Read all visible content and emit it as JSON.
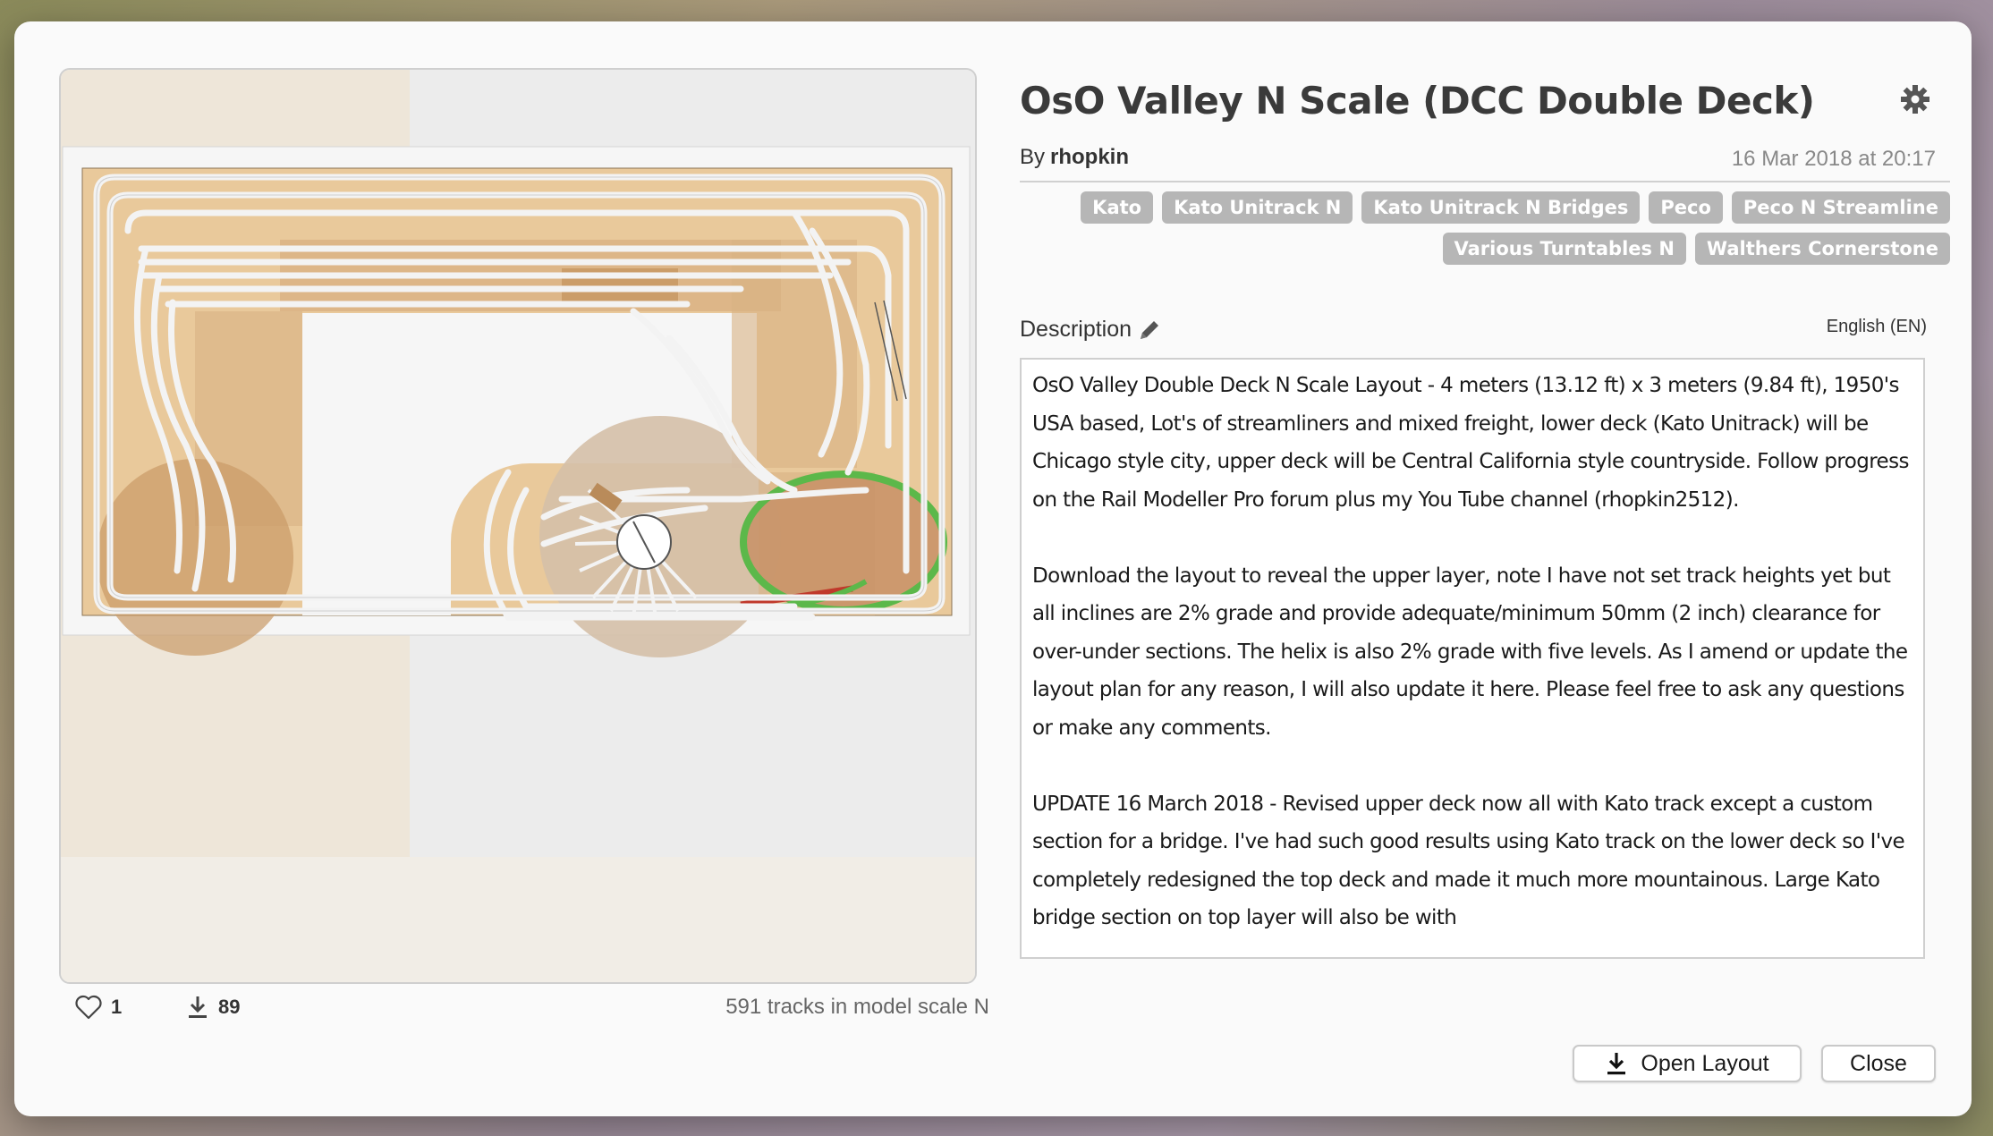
{
  "layout": {
    "title": "OsO Valley N Scale (DCC Double Deck)",
    "by_label": "By",
    "author": "rhopkin",
    "date": "16 Mar 2018 at 20:17",
    "tags": [
      "Kato",
      "Kato Unitrack N",
      "Kato Unitrack N Bridges",
      "Peco",
      "Peco N Streamline",
      "Various Turntables N",
      "Walthers Cornerstone"
    ],
    "likes": "1",
    "downloads": "89",
    "track_summary": "591 tracks in model scale N"
  },
  "description": {
    "label": "Description",
    "language": "English (EN)",
    "paragraphs": [
      "OsO Valley Double Deck N Scale Layout - 4 meters (13.12 ft) x 3 meters (9.84 ft),  1950's USA based, Lot's of streamliners and mixed freight, lower deck (Kato Unitrack) will be Chicago style city, upper deck will be Central California style countryside. Follow progress on the Rail Modeller Pro forum plus my You Tube channel (rhopkin2512).",
      "Download the layout to reveal the upper layer, note I have not set track heights yet but all inclines are 2% grade and provide adequate/minimum 50mm (2 inch) clearance for over-under sections. The helix is also 2% grade with five levels. As I amend or update the layout plan for any reason, I will also update it here. Please feel free to ask any questions or make any comments.",
      "UPDATE 16 March 2018 - Revised upper deck now all with Kato track except a custom section for a bridge. I've had such good results using Kato track on the lower deck so I've completely redesigned the top deck and made it much more mountainous. Large Kato bridge section on top layer will also be with"
    ]
  },
  "buttons": {
    "open_layout": "Open Layout",
    "close": "Close"
  },
  "icons": {
    "settings": "gear-icon",
    "edit": "pencil-icon",
    "like": "heart-icon",
    "download": "download-icon"
  },
  "colors": {
    "tag_bg": "#b6b6b6",
    "baseboard": "#e8c898",
    "track": "#f2f2f2",
    "track_green": "#5cb84a",
    "track_red": "#c0392b"
  }
}
